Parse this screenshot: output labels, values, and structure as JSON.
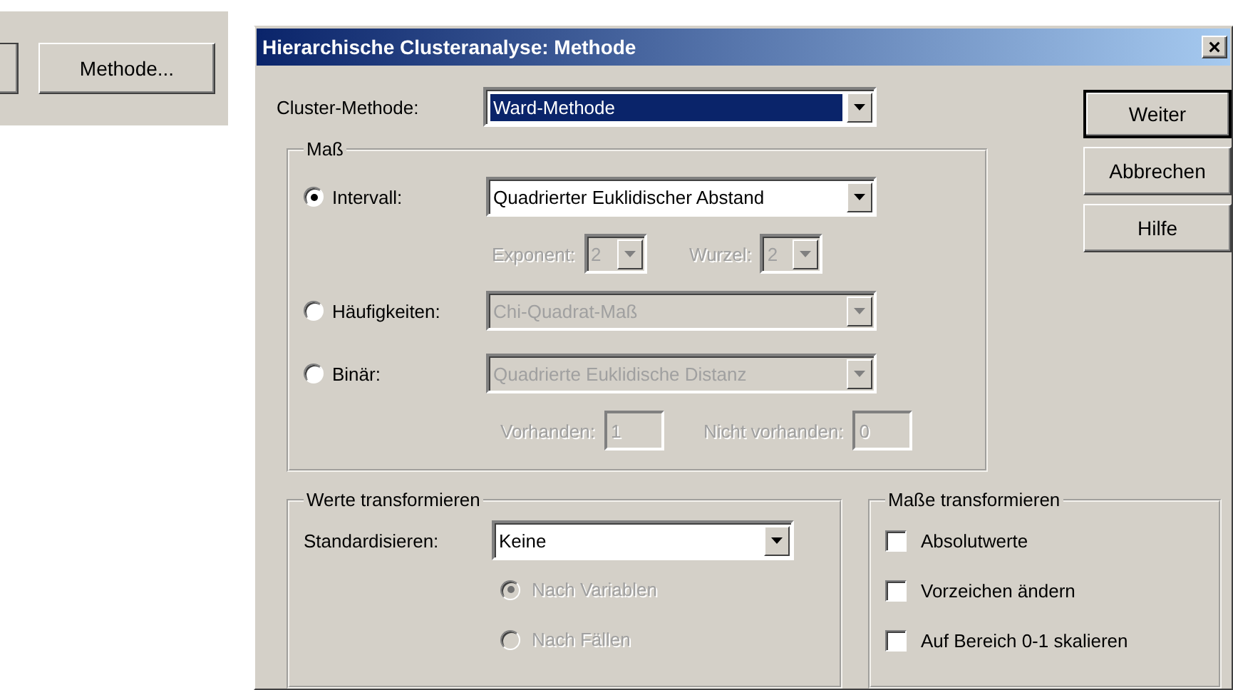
{
  "background_button": {
    "label": "Methode..."
  },
  "dialog": {
    "title": "Hierarchische Clusteranalyse: Methode",
    "close": "×"
  },
  "cluster_method": {
    "label": "Cluster-Methode:",
    "value": "Ward-Methode"
  },
  "buttons": [
    {
      "label": "Weiter",
      "default": true
    },
    {
      "label": "Abbrechen",
      "default": false
    },
    {
      "label": "Hilfe",
      "default": false
    }
  ],
  "measure": {
    "title": "Maß",
    "options": [
      {
        "label": "Intervall:",
        "selected": true,
        "value": "Quadrierter Euklidischer Abstand",
        "disabled": false
      },
      {
        "label": "Häufigkeiten:",
        "selected": false,
        "value": "Chi-Quadrat-Maß",
        "disabled": true
      },
      {
        "label": "Binär:",
        "selected": false,
        "value": "Quadrierte Euklidische Distanz",
        "disabled": true
      }
    ],
    "interval_params": [
      {
        "label": "Exponent:",
        "value": "2",
        "disabled": true
      },
      {
        "label": "Wurzel:",
        "value": "2",
        "disabled": true
      }
    ],
    "binary_params": [
      {
        "label": "Vorhanden:",
        "value": "1",
        "disabled": true
      },
      {
        "label": "Nicht vorhanden:",
        "value": "0",
        "disabled": true
      }
    ]
  },
  "transform_values": {
    "title": "Werte transformieren",
    "standardize": {
      "label": "Standardisieren:",
      "value": "Keine"
    },
    "options": [
      {
        "label": "Nach Variablen",
        "selected": true,
        "disabled": true
      },
      {
        "label": "Nach Fällen",
        "selected": false,
        "disabled": true
      }
    ]
  },
  "transform_measures": {
    "title": "Maße transformieren",
    "options": [
      {
        "label": "Absolutwerte",
        "checked": false
      },
      {
        "label": "Vorzeichen ändern",
        "checked": false
      },
      {
        "label": "Auf Bereich 0-1 skalieren",
        "checked": false
      }
    ]
  }
}
